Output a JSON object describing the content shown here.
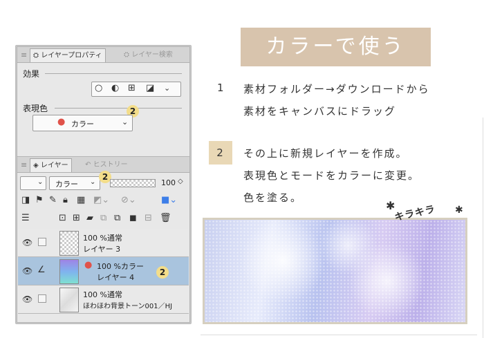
{
  "panel": {
    "props_tabs": {
      "active": "レイヤープロパティ",
      "inactive": "レイヤー検索"
    },
    "effect_label": "効果",
    "expression_label": "表現色",
    "expression_value": "カラー",
    "layer_tabs": {
      "active": "レイヤー",
      "inactive": "ヒストリー"
    },
    "blend_mode": "カラー",
    "opacity": "100",
    "badge": "2",
    "layers": [
      {
        "line1": "100 %通常",
        "line2": "レイヤー 3"
      },
      {
        "line1": "100 %カラー",
        "line2": "レイヤー 4"
      },
      {
        "line1": "100 %通常",
        "line2": "ほわほわ背景トーン001／HJ"
      }
    ]
  },
  "article": {
    "banner": "カラーで使う",
    "step1_num": "1",
    "step1_line1": "素材フォルダー→ダウンロードから",
    "step1_line2": "素材をキャンバスにドラッグ",
    "step2_num": "2",
    "step2_line1": "その上に新規レイヤーを作成。",
    "step2_line2": "表現色とモードをカラーに変更。",
    "step2_line3": "色を塗る。",
    "sparkle_text": "キラキラ"
  },
  "colors": {
    "banner_bg": "#d8c4ad",
    "badge": "#f3dd8a",
    "selected_row": "#a9c4de",
    "step_num_bg": "#e9d8b6"
  }
}
